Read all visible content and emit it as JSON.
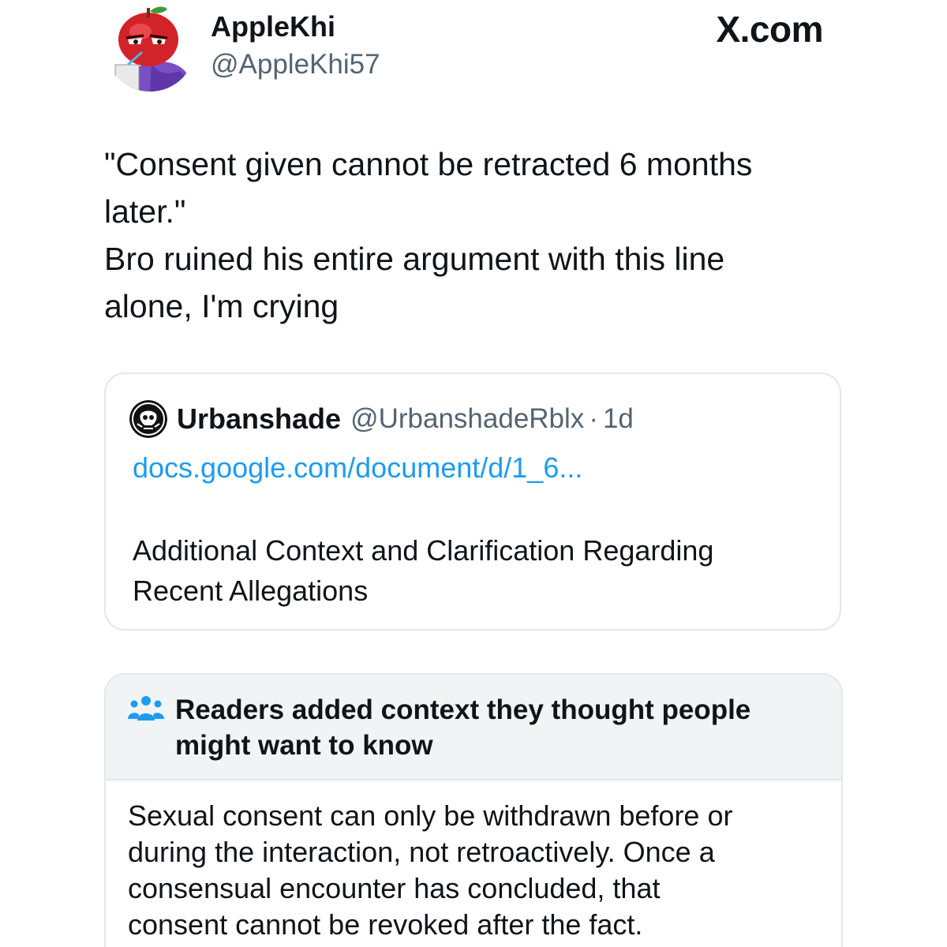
{
  "author": {
    "display_name": "AppleKhi",
    "handle": "@AppleKhi57"
  },
  "site_label": "X.com",
  "tweet": {
    "lines": [
      "\"Consent given cannot be retracted 6 months",
      "later.\"",
      "Bro ruined his entire argument with this line",
      "alone, I'm crying"
    ]
  },
  "quote": {
    "display_name": "Urbanshade",
    "handle": "@UrbanshadeRblx",
    "separator": "·",
    "time": "1d",
    "link": "docs.google.com/document/d/1_6...",
    "body_lines": [
      "Additional Context and Clarification Regarding",
      "Recent Allegations"
    ]
  },
  "community_note": {
    "icon": "people-icon",
    "title_lines": [
      "Readers added context they thought people",
      "might want to know"
    ],
    "body_lines": [
      "Sexual consent can only be withdrawn before or",
      "during the interaction, not retroactively. Once a",
      "consensual encounter has concluded, that",
      "consent cannot be revoked after the fact."
    ]
  },
  "colors": {
    "link": "#1d9bf0",
    "secondary_text": "#536471",
    "note_header_bg": "#f0f4f5",
    "note_icon": "#1d9bf0",
    "border": "#e1e8ed"
  }
}
